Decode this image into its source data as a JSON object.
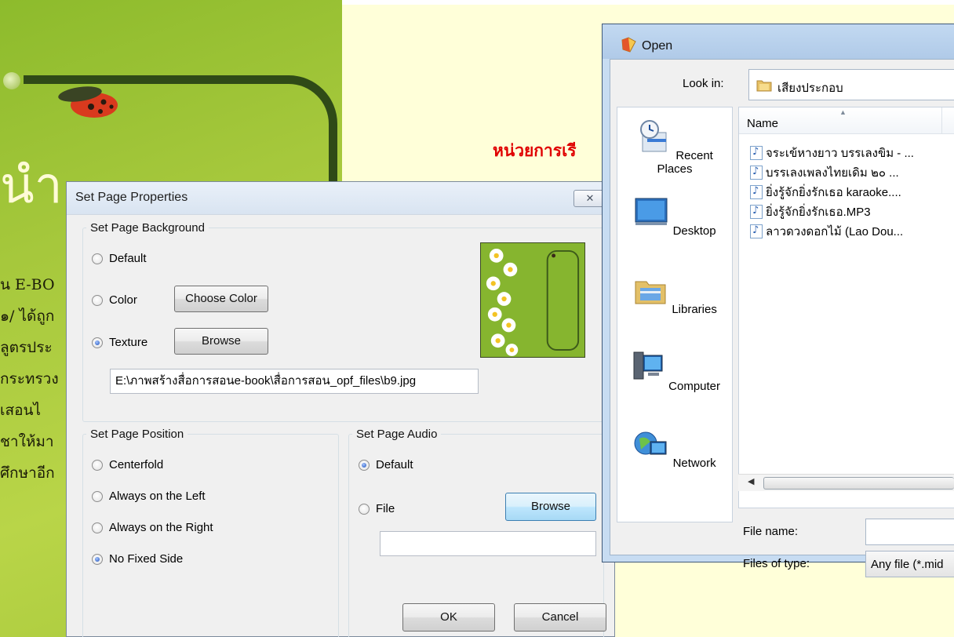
{
  "background": {
    "big_glyph": "นำ",
    "side_lines": [
      "น E-BO",
      "๑/ ได้ถูก",
      "ลูตรประ",
      "กระทรวง",
      "เสอนไ",
      "ชาให้มา",
      "ศึกษาอีก"
    ],
    "heading": "หน่วยการเรี"
  },
  "page_properties": {
    "title": "Set Page Properties",
    "close_glyph": "✕",
    "background_group": {
      "legend": "Set Page Background",
      "default_label": "Default",
      "color_label": "Color",
      "choose_color_label": "Choose Color",
      "texture_label": "Texture",
      "browse_label": "Browse",
      "texture_path": "E:\\ภาพสร้างสื่อการสอนe-book\\สื่อการสอน_opf_files\\b9.jpg",
      "selected": "Texture"
    },
    "position_group": {
      "legend": "Set Page Position",
      "options": [
        "Centerfold",
        "Always on the Left",
        "Always on the Right",
        "No Fixed Side"
      ],
      "selected": "No Fixed Side"
    },
    "audio_group": {
      "legend": "Set Page Audio",
      "default_label": "Default",
      "file_label": "File",
      "browse_label": "Browse",
      "file_path": "",
      "selected": "Default"
    },
    "ok_label": "OK",
    "cancel_label": "Cancel"
  },
  "open_dialog": {
    "title": "Open",
    "look_in_label": "Look in:",
    "look_in_value": "เสียงประกอบ",
    "places": [
      "Recent Places",
      "Desktop",
      "Libraries",
      "Computer",
      "Network"
    ],
    "column_name": "Name",
    "files": [
      "จระเข้หางยาว บรรเลงขิม - ...",
      "บรรเลงเพลงไทยเดิม ๒๐ ...",
      "ยิ่งรู้จักยิ่งรักเธอ karaoke....",
      "ยิ่งรู้จักยิ่งรักเธอ.MP3",
      "ลาวดวงดอกไม้ (Lao Dou..."
    ],
    "file_name_label": "File name:",
    "file_name_value": "",
    "files_of_type_label": "Files of type:",
    "files_of_type_value": "Any file (*.mid"
  }
}
